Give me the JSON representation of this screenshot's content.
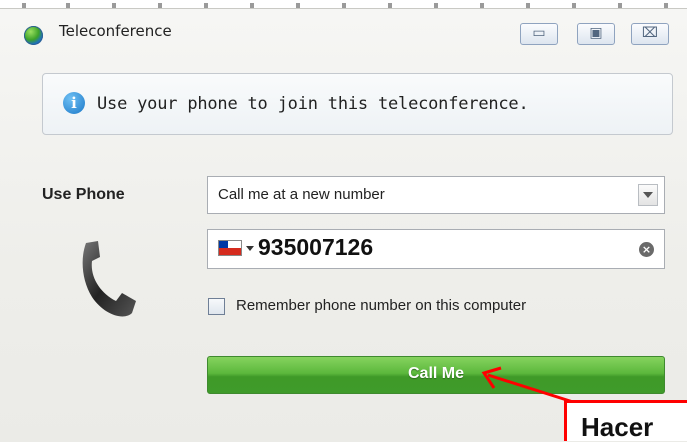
{
  "window": {
    "title": "Teleconference",
    "icon": "app-globe-icon",
    "controls": {
      "minimize": "▭",
      "maximize": "▣",
      "close": "⌧"
    }
  },
  "info": {
    "text": "Use your phone to join this teleconference.",
    "icon": "info-icon"
  },
  "phone_section": {
    "label": "Use Phone",
    "select_value": "Call me at a new number",
    "country_flag": "chile-flag",
    "phone_number": "935007126",
    "clear_icon": "×",
    "remember_label": "Remember phone number on this computer",
    "remember_checked": false
  },
  "call_button": {
    "label": "Call Me",
    "color": "#4caf3a"
  },
  "annotation": {
    "text": "Hacer",
    "color": "#ff0000"
  }
}
